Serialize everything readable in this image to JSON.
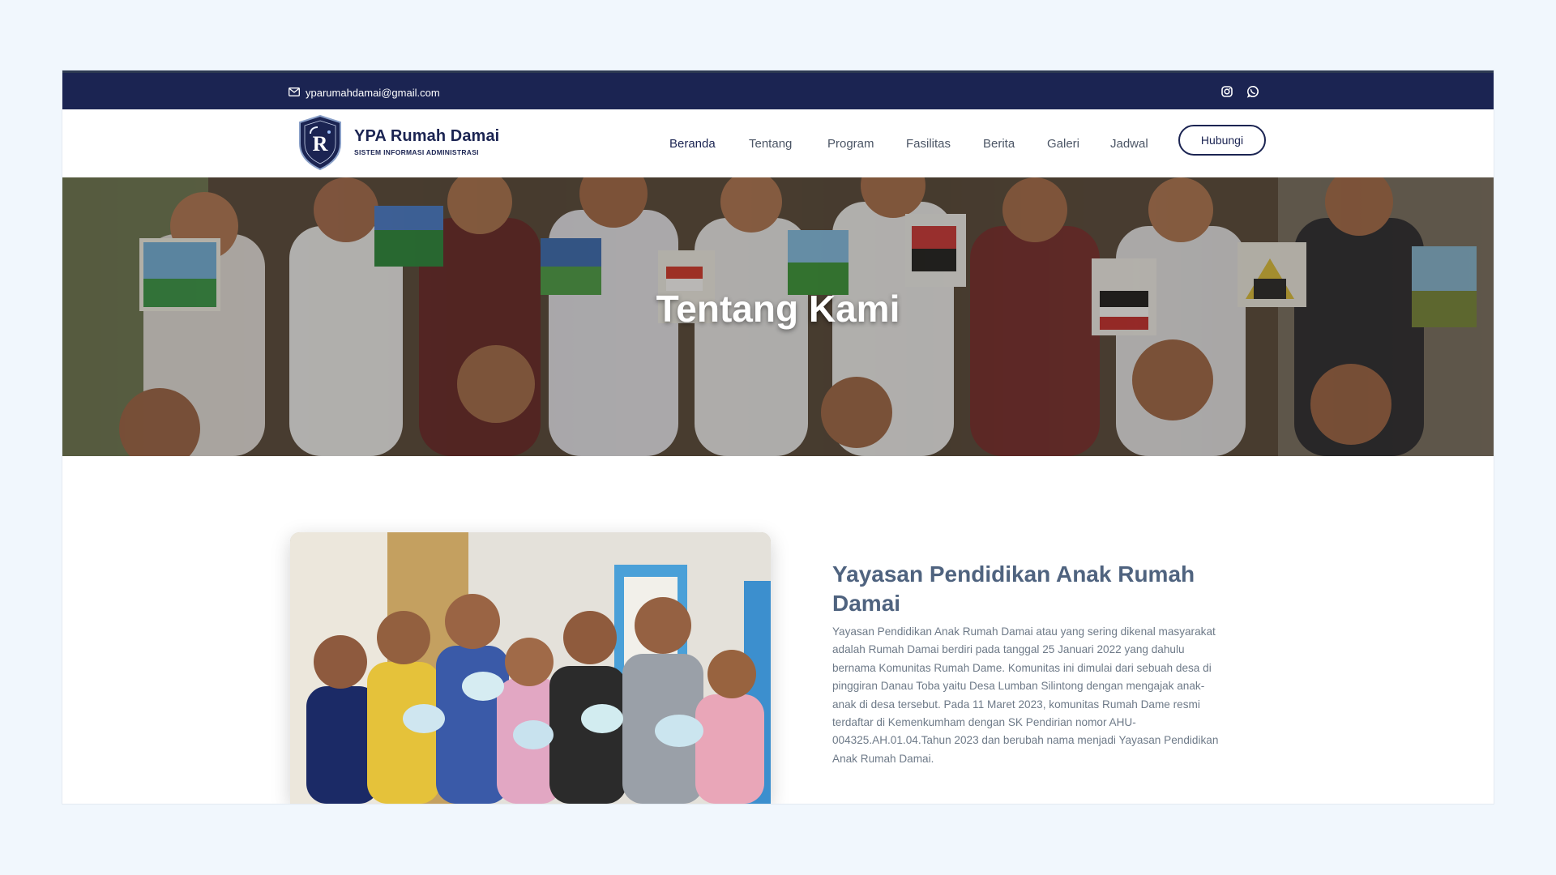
{
  "topbar": {
    "email": "yparumahdamai@gmail.com",
    "email_icon": "mail-icon",
    "socials": [
      {
        "name": "instagram",
        "icon": "instagram-icon"
      },
      {
        "name": "whatsapp",
        "icon": "whatsapp-icon"
      }
    ]
  },
  "header": {
    "brand_name": "YPA Rumah Damai",
    "brand_tagline": "SISTEM INFORMASI ADMINISTRASI",
    "nav": [
      {
        "label": "Beranda",
        "active": true
      },
      {
        "label": "Tentang",
        "active": false
      },
      {
        "label": "Program",
        "active": false
      },
      {
        "label": "Fasilitas",
        "active": false
      },
      {
        "label": "Berita",
        "active": false
      },
      {
        "label": "Galeri",
        "active": false
      },
      {
        "label": "Jadwal",
        "active": false
      }
    ],
    "cta_label": "Hubungi"
  },
  "hero": {
    "title": "Tentang Kami"
  },
  "about": {
    "title": "Yayasan Pendidikan Anak Rumah Damai",
    "body": "Yayasan Pendidikan Anak Rumah Damai atau yang sering dikenal masyarakat adalah Rumah Damai berdiri pada tanggal 25 Januari 2022 yang dahulu bernama Komunitas Rumah Dame. Komunitas ini dimulai dari sebuah desa di pinggiran Danau Toba yaitu Desa Lumban Silintong dengan mengajak anak-anak di desa tersebut. Pada 11 Maret 2023, komunitas Rumah Dame resmi terdaftar di Kemenkumham dengan SK Pendirian nomor AHU-004325.AH.01.04.Tahun 2023 dan berubah nama menjadi Yayasan Pendidikan Anak Rumah Damai."
  },
  "colors": {
    "navy": "#1b2452",
    "page_bg": "#f1f7fd",
    "heading": "#4f637f",
    "body_text": "#6e7a88"
  }
}
